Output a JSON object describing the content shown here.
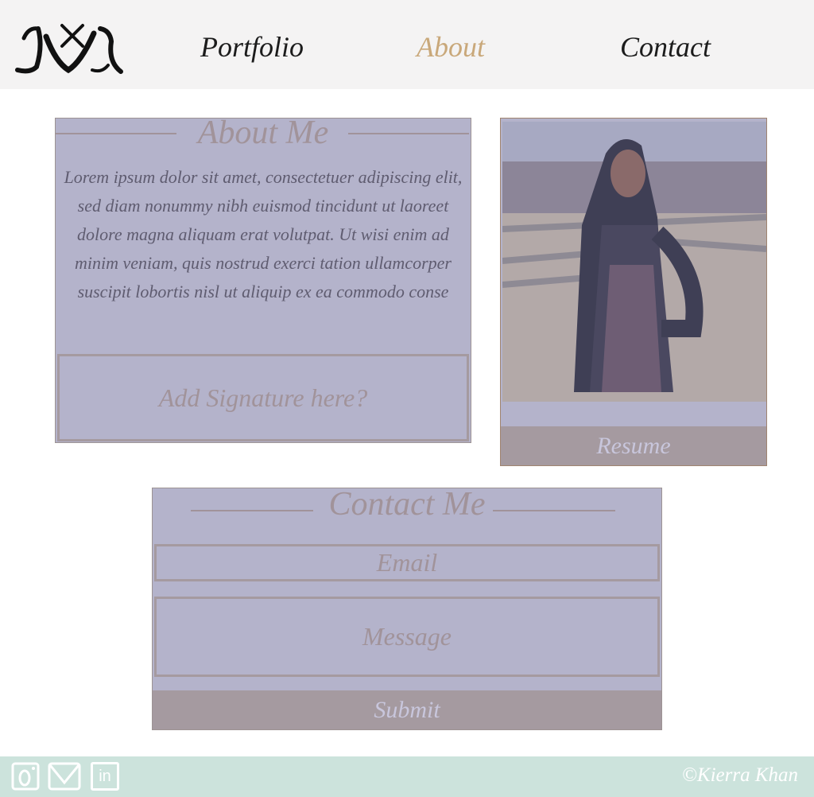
{
  "header": {
    "logo_text": "KK",
    "nav": [
      {
        "label": "Portfolio",
        "active": false
      },
      {
        "label": "About",
        "active": true
      },
      {
        "label": "Contact",
        "active": false
      }
    ],
    "active_color": "#c9a87a"
  },
  "about": {
    "title": "About Me",
    "body": "Lorem ipsum dolor sit amet, consectetuer adipiscing elit, sed diam nonummy nibh euismod tincidunt ut laoreet dolore magna aliquam erat volutpat. Ut wisi enim ad minim veniam, quis nostrud exerci tation ullamcorper suscipit lobortis nisl ut aliquip ex ea commodo conse",
    "signature_placeholder": "Add Signature here?"
  },
  "photo": {
    "resume_label": "Resume"
  },
  "contact": {
    "title": "Contact Me",
    "email_placeholder": "Email",
    "message_placeholder": "Message",
    "submit_label": "Submit"
  },
  "footer": {
    "icons": [
      "instagram-icon",
      "mail-icon",
      "linkedin-icon"
    ],
    "linkedin_text": "in",
    "copyright": "©Kierra Khan"
  },
  "colors": {
    "panel": "#b4b3cb",
    "border": "#9d9393",
    "button": "#a59aa0",
    "footer": "#cce3dc"
  }
}
